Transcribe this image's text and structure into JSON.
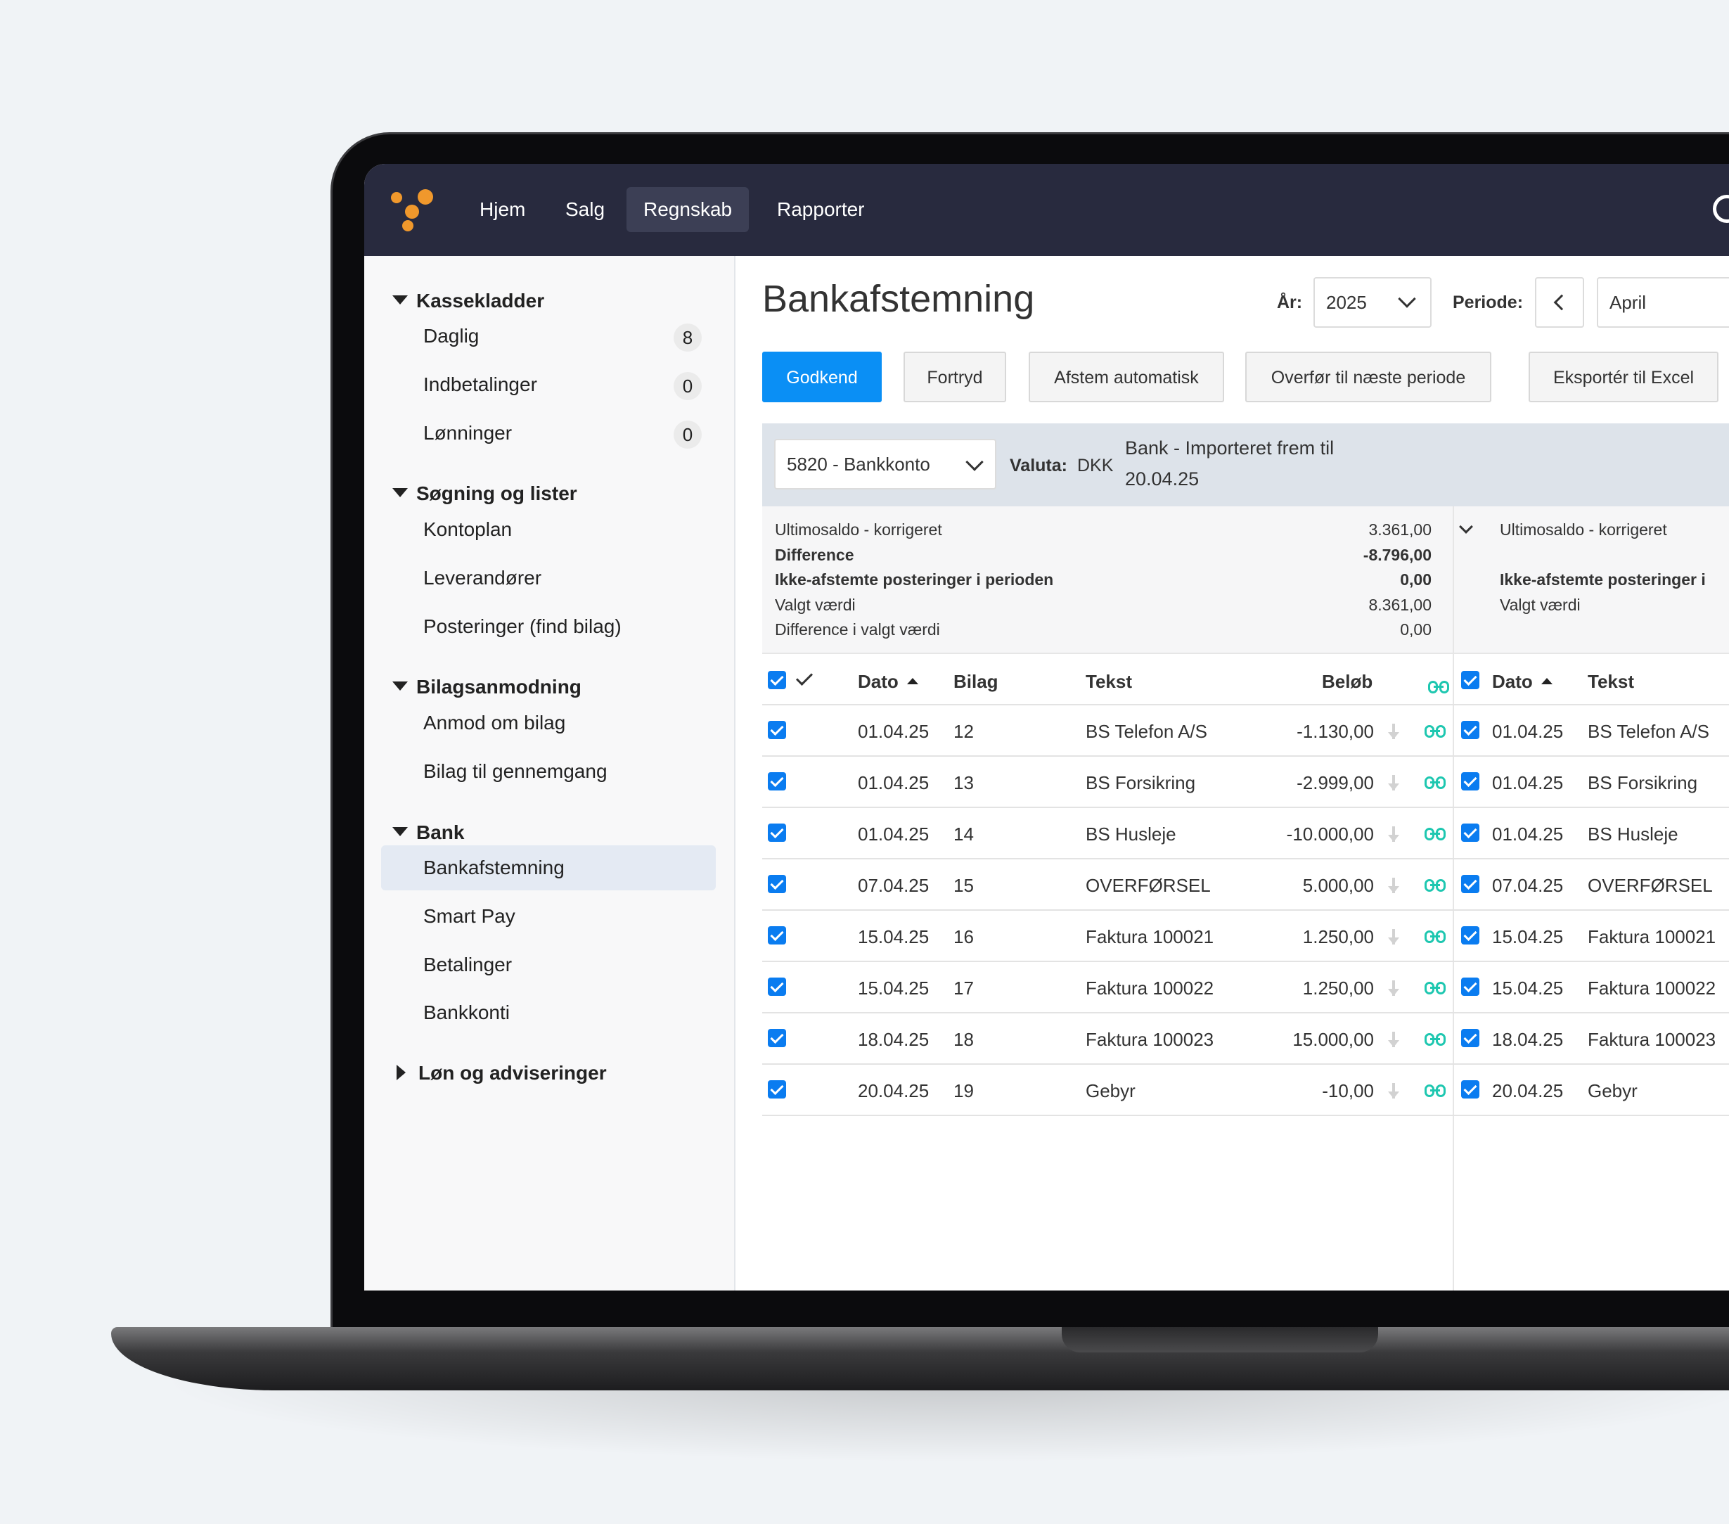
{
  "nav": {
    "items": [
      "Hjem",
      "Salg",
      "Regnskab",
      "Rapporter"
    ],
    "active": "Regnskab"
  },
  "sidebar": {
    "sections": [
      {
        "title": "Kassekladder",
        "expanded": true
      },
      {
        "title": "Søgning og lister",
        "expanded": true
      },
      {
        "title": "Bilagsanmodning",
        "expanded": true
      },
      {
        "title": "Bank",
        "expanded": true
      },
      {
        "title": "Løn og adviseringer",
        "expanded": false
      }
    ],
    "items": [
      {
        "label": "Daglig",
        "badge": "8"
      },
      {
        "label": "Indbetalinger",
        "badge": "0"
      },
      {
        "label": "Lønninger",
        "badge": "0"
      },
      {
        "label": "Kontoplan"
      },
      {
        "label": "Leverandører"
      },
      {
        "label": "Posteringer (find bilag)"
      },
      {
        "label": "Anmod om bilag"
      },
      {
        "label": "Bilag til gennemgang"
      },
      {
        "label": "Bankafstemning",
        "active": true
      },
      {
        "label": "Smart Pay"
      },
      {
        "label": "Betalinger"
      },
      {
        "label": "Bankkonti"
      }
    ]
  },
  "page": {
    "title": "Bankafstemning",
    "year_label": "År:",
    "year_value": "2025",
    "period_label": "Periode:",
    "period_value": "April"
  },
  "toolbar": {
    "approve": "Godkend",
    "undo": "Fortryd",
    "auto": "Afstem automatisk",
    "transfer": "Overfør til næste periode",
    "export": "Eksportér til Excel"
  },
  "account": {
    "selected": "5820 - Bankkonto",
    "currency_label": "Valuta:",
    "currency_value": "DKK",
    "import_line1": "Bank - Importeret frem til",
    "import_line2": "20.04.25"
  },
  "summary_left": [
    {
      "label": "Ultimosaldo - korrigeret",
      "value": "3.361,00",
      "bold": false
    },
    {
      "label": "Difference",
      "value": "-8.796,00",
      "bold": true
    },
    {
      "label": "Ikke-afstemte posteringer i perioden",
      "value": "0,00",
      "bold": true
    },
    {
      "label": "Valgt værdi",
      "value": "8.361,00",
      "bold": false
    },
    {
      "label": "Difference i valgt værdi",
      "value": "0,00",
      "bold": false
    }
  ],
  "summary_right": [
    {
      "label": "Ultimosaldo - korrigeret"
    },
    {
      "label": "Ikke-afstemte posteringer i"
    },
    {
      "label": "Valgt værdi"
    }
  ],
  "table": {
    "headers": {
      "dato": "Dato",
      "bilag": "Bilag",
      "tekst": "Tekst",
      "belob": "Beløb"
    },
    "rows": [
      {
        "dato": "01.04.25",
        "bilag": "12",
        "tekst": "BS Telefon A/S",
        "belob": "-1.130,00"
      },
      {
        "dato": "01.04.25",
        "bilag": "13",
        "tekst": "BS Forsikring",
        "belob": "-2.999,00"
      },
      {
        "dato": "01.04.25",
        "bilag": "14",
        "tekst": "BS Husleje",
        "belob": "-10.000,00"
      },
      {
        "dato": "07.04.25",
        "bilag": "15",
        "tekst": "OVERFØRSEL",
        "belob": "5.000,00"
      },
      {
        "dato": "15.04.25",
        "bilag": "16",
        "tekst": "Faktura 100021",
        "belob": "1.250,00"
      },
      {
        "dato": "15.04.25",
        "bilag": "17",
        "tekst": "Faktura 100022",
        "belob": "1.250,00"
      },
      {
        "dato": "18.04.25",
        "bilag": "18",
        "tekst": "Faktura 100023",
        "belob": "15.000,00"
      },
      {
        "dato": "20.04.25",
        "bilag": "19",
        "tekst": "Gebyr",
        "belob": "-10,00"
      }
    ]
  },
  "right_table": {
    "headers": {
      "dato": "Dato",
      "tekst": "Tekst"
    },
    "rows": [
      {
        "dato": "01.04.25",
        "tekst": "BS Telefon A/S"
      },
      {
        "dato": "01.04.25",
        "tekst": "BS Forsikring"
      },
      {
        "dato": "01.04.25",
        "tekst": "BS Husleje"
      },
      {
        "dato": "07.04.25",
        "tekst": "OVERFØRSEL"
      },
      {
        "dato": "15.04.25",
        "tekst": "Faktura 100021"
      },
      {
        "dato": "15.04.25",
        "tekst": "Faktura 100022"
      },
      {
        "dato": "18.04.25",
        "tekst": "Faktura 100023"
      },
      {
        "dato": "20.04.25",
        "tekst": "Gebyr"
      }
    ]
  },
  "colors": {
    "topbar": "#282a3e",
    "accent": "#0a8ff5",
    "logo": "#f0982c",
    "link": "#1ec7b0"
  }
}
